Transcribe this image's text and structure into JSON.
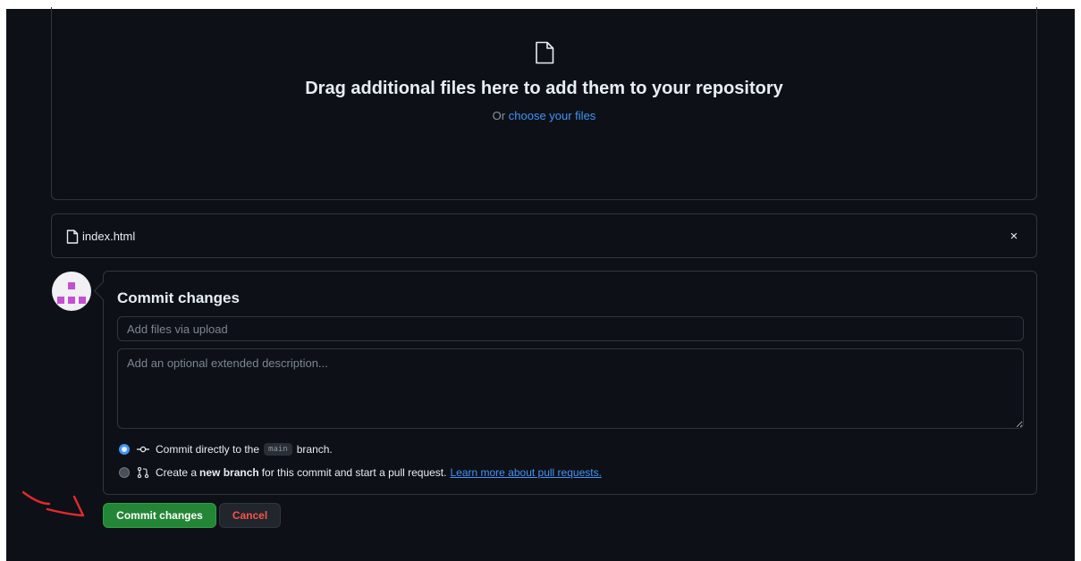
{
  "dropzone": {
    "icon": "file-icon",
    "title": "Drag additional files here to add them to your repository",
    "prefix": "Or",
    "choose_link": "choose your files"
  },
  "file": {
    "icon": "file-icon",
    "name": "index.html",
    "close_icon": "close-icon",
    "close_glyph": "×"
  },
  "commit": {
    "title": "Commit changes",
    "summary_placeholder": "Add files via upload",
    "description_placeholder": "Add an optional extended description...",
    "option_direct": {
      "selected": true,
      "icon": "git-commit-icon",
      "text_before": "Commit directly to the",
      "branch": "main",
      "text_after": "branch."
    },
    "option_new_branch": {
      "selected": false,
      "icon": "git-pull-request-icon",
      "text_before": "Create a",
      "bold": "new branch",
      "text_after": "for this commit and start a pull request.",
      "link": "Learn more about pull requests."
    }
  },
  "buttons": {
    "commit_label": "Commit changes",
    "cancel_label": "Cancel"
  },
  "colors": {
    "background": "#0d1117",
    "border": "#30363d",
    "link": "#4493f8",
    "primary_button": "#238636",
    "danger_text": "#f85149",
    "annotation": "#e5292c"
  }
}
